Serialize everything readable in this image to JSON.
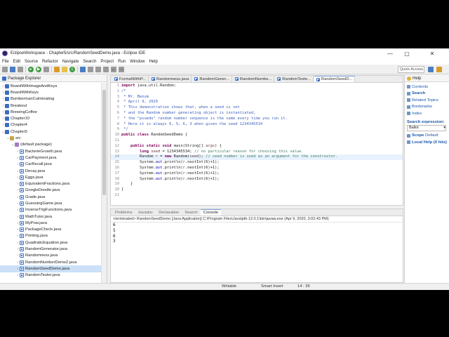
{
  "window": {
    "title": "EclipseWorkspace - Chapter5/src/RandomSeedDemo.java - Eclipse IDE",
    "controls": [
      "—",
      "▢",
      "✕"
    ]
  },
  "menu": [
    "File",
    "Edit",
    "Source",
    "Refactor",
    "Navigate",
    "Search",
    "Project",
    "Run",
    "Window",
    "Help"
  ],
  "toolbar": {
    "quick_access": "Quick Access"
  },
  "package_explorer": {
    "title": "Package Explorer",
    "items": [
      {
        "label": "BoardWithImageAndKeys",
        "level": 0,
        "kind": "proj",
        "twisty": "›"
      },
      {
        "label": "BoardWithKeys",
        "level": 0,
        "kind": "proj",
        "twisty": "›"
      },
      {
        "label": "BombermanCulminating",
        "level": 0,
        "kind": "proj",
        "twisty": "›"
      },
      {
        "label": "Breakout",
        "level": 0,
        "kind": "proj",
        "twisty": "›"
      },
      {
        "label": "BrewingCoffee",
        "level": 0,
        "kind": "proj",
        "twisty": "›"
      },
      {
        "label": "Chapter10",
        "level": 0,
        "kind": "proj",
        "twisty": "›"
      },
      {
        "label": "Chapter4",
        "level": 0,
        "kind": "proj",
        "twisty": "›"
      },
      {
        "label": "Chapter5",
        "level": 0,
        "kind": "proj",
        "twisty": "⌄"
      },
      {
        "label": "src",
        "level": 1,
        "kind": "src",
        "twisty": "⌄"
      },
      {
        "label": "(default package)",
        "level": 2,
        "kind": "pkgi",
        "twisty": "⌄"
      },
      {
        "label": "BacterieGrowth.java",
        "level": 3,
        "kind": "java",
        "twisty": "›"
      },
      {
        "label": "CarPayment.java",
        "level": 3,
        "kind": "java",
        "twisty": "›"
      },
      {
        "label": "CarRecall.java",
        "level": 3,
        "kind": "java",
        "twisty": "›"
      },
      {
        "label": "Decay.java",
        "level": 3,
        "kind": "java",
        "twisty": "›"
      },
      {
        "label": "Eggs.java",
        "level": 3,
        "kind": "java",
        "twisty": "›"
      },
      {
        "label": "EquivalentFractions.java",
        "level": 3,
        "kind": "java",
        "twisty": "›"
      },
      {
        "label": "GoogleDoodle.java",
        "level": 3,
        "kind": "java",
        "twisty": "›"
      },
      {
        "label": "Grade.java",
        "level": 3,
        "kind": "java",
        "twisty": "›"
      },
      {
        "label": "GuessingGame.java",
        "level": 3,
        "kind": "java",
        "twisty": "›"
      },
      {
        "label": "InverseTrigFunctions.java",
        "level": 3,
        "kind": "java",
        "twisty": "›"
      },
      {
        "label": "MathTutor.java",
        "level": 3,
        "kind": "java",
        "twisty": "›"
      },
      {
        "label": "MyPow.java",
        "level": 3,
        "kind": "java",
        "twisty": "›"
      },
      {
        "label": "PackageCheck.java",
        "level": 3,
        "kind": "java",
        "twisty": "›"
      },
      {
        "label": "Printing.java",
        "level": 3,
        "kind": "java",
        "twisty": "›"
      },
      {
        "label": "QuadraticEquation.java",
        "level": 3,
        "kind": "java",
        "twisty": "›"
      },
      {
        "label": "RandomGenerator.java",
        "level": 3,
        "kind": "java",
        "twisty": "›"
      },
      {
        "label": "Randomness.java",
        "level": 3,
        "kind": "java",
        "twisty": "›"
      },
      {
        "label": "RandomNumberDemo2.java",
        "level": 3,
        "kind": "java",
        "twisty": "›"
      },
      {
        "label": "RandomSeedDemo.java",
        "level": 3,
        "kind": "java",
        "twisty": "›",
        "selected": true
      },
      {
        "label": "RandomTester.java",
        "level": 3,
        "kind": "java",
        "twisty": "›"
      }
    ]
  },
  "editor": {
    "tabs": [
      {
        "label": "FormatWithP...",
        "active": false
      },
      {
        "label": "Randomness.java",
        "active": false
      },
      {
        "label": "RandomGener...",
        "active": false
      },
      {
        "label": "RandomNumbe...",
        "active": false
      },
      {
        "label": "RandomTeste...",
        "active": false
      },
      {
        "label": "RandomSeedD...",
        "active": true
      }
    ],
    "lines": [
      {
        "n": "1",
        "html": "<span class='k'>import</span> java.util.Random;"
      },
      {
        "n": "2",
        "html": "<span class='jd'>/*</span>"
      },
      {
        "n": "3",
        "html": "<span class='jd'> * Mr. Benum</span>"
      },
      {
        "n": "4",
        "html": "<span class='jd'> * April 9, 2020</span>"
      },
      {
        "n": "5",
        "html": "<span class='jd'> * This demonstration shows that, when a seed is set</span>"
      },
      {
        "n": "6",
        "html": "<span class='jd'> * and the Random number generating object is instantiated,</span>"
      },
      {
        "n": "7",
        "html": "<span class='jd'> * the \"psuedo\" random number sequence is the same every time you run it.</span>"
      },
      {
        "n": "8",
        "html": "<span class='jd'> * Here it is always 6, 5, 6, 3 when given the seed 1234345534</span>"
      },
      {
        "n": "9",
        "html": "<span class='jd'> */</span>"
      },
      {
        "n": "10",
        "html": "<span class='k'>public class</span> RandomSeedDemo {"
      },
      {
        "n": "11",
        "html": ""
      },
      {
        "n": "12",
        "html": "    <span class='k'>public static void</span> main(String[] <span class='lv'>args</span>) {"
      },
      {
        "n": "13",
        "html": "        <span class='k'>long</span> <span class='lv'>seed</span> = 1234345534; <span class='c'>// no particular reason for choosing this value.</span>"
      },
      {
        "n": "14",
        "html": "        Random <span class='lv'>r</span> = <span class='k'>new</span> Random(<span class='lv'>seed</span>); <span class='c'>// seed number is used as an argument for the constructor.</span>",
        "current": true
      },
      {
        "n": "15",
        "html": "        System.<span class='v'><i>out</i></span>.println(<span class='lv'>r</span>.nextInt(6)+1);"
      },
      {
        "n": "16",
        "html": "        System.<span class='v'><i>out</i></span>.println(<span class='lv'>r</span>.nextInt(6)+1);"
      },
      {
        "n": "17",
        "html": "        System.<span class='v'><i>out</i></span>.println(<span class='lv'>r</span>.nextInt(6)+1);"
      },
      {
        "n": "18",
        "html": "        System.<span class='v'><i>out</i></span>.println(<span class='lv'>r</span>.nextInt(6)+1);"
      },
      {
        "n": "19",
        "html": "    }"
      },
      {
        "n": "20",
        "html": "}"
      },
      {
        "n": "21",
        "html": ""
      }
    ]
  },
  "help": {
    "title": "Help",
    "links": [
      {
        "label": "Contents",
        "bold": false
      },
      {
        "label": "Search",
        "bold": true
      },
      {
        "label": "Related Topics",
        "bold": false
      },
      {
        "label": "Bookmarks",
        "bold": false
      },
      {
        "label": "Index",
        "bold": false
      }
    ],
    "search_label": "Search expression:",
    "search_value": "Ballot",
    "scope_label": "Scope",
    "scope_value": "Default",
    "local_help": "Local Help (0 hits)"
  },
  "console": {
    "tabs": [
      {
        "label": "Problems",
        "active": false
      },
      {
        "label": "Javadoc",
        "active": false
      },
      {
        "label": "Declaration",
        "active": false
      },
      {
        "label": "Search",
        "active": false
      },
      {
        "label": "Console",
        "active": true
      }
    ],
    "terminated": "<terminated> RandomSeedDemo [Java Application] C:\\Program Files\\Java\\jdk-12.0.1\\bin\\javaw.exe (Apr 9, 2020, 3:02:43 PM)",
    "output": [
      "6",
      "5",
      "6",
      "3"
    ]
  },
  "status": {
    "writable": "Writable",
    "insert_mode": "Smart Insert",
    "position": "14 : 35"
  }
}
